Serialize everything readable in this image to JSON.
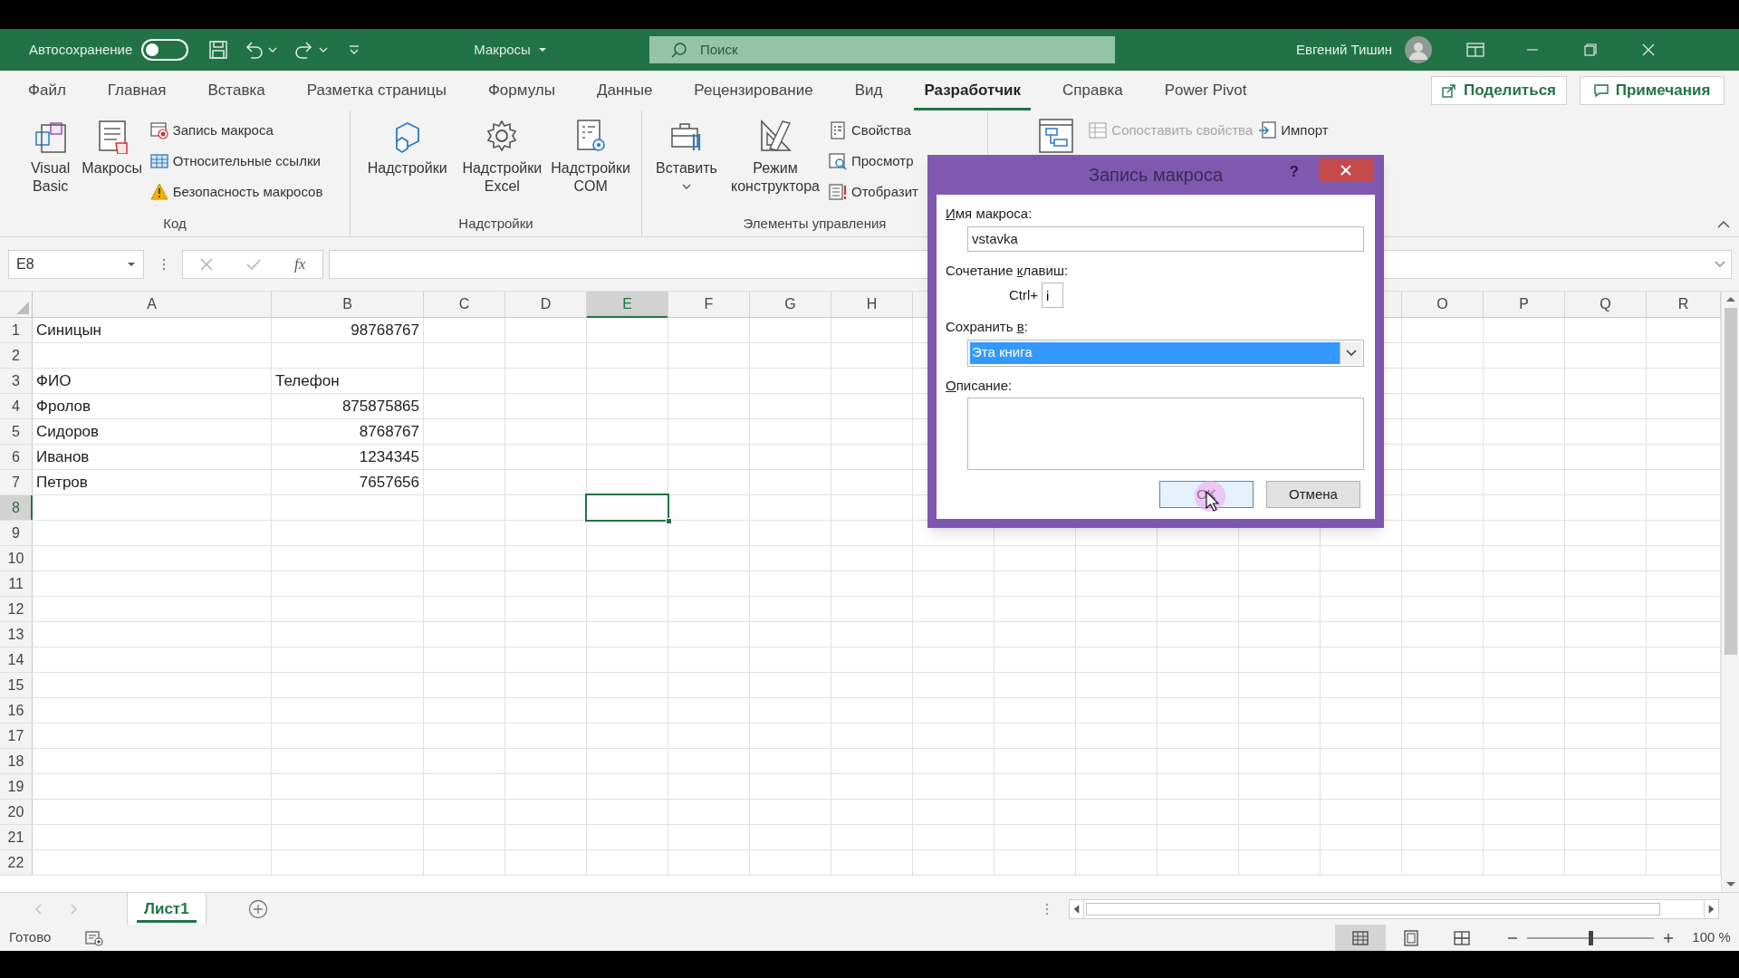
{
  "title_bar": {
    "autosave_label": "Автосохранение",
    "autosave_on": false,
    "document_title": "Макросы",
    "search_placeholder": "Поиск",
    "user_name": "Евгений Тишин"
  },
  "tabs": [
    {
      "label": "Файл",
      "selected": false
    },
    {
      "label": "Главная",
      "selected": false
    },
    {
      "label": "Вставка",
      "selected": false
    },
    {
      "label": "Разметка страницы",
      "selected": false
    },
    {
      "label": "Формулы",
      "selected": false
    },
    {
      "label": "Данные",
      "selected": false
    },
    {
      "label": "Рецензирование",
      "selected": false
    },
    {
      "label": "Вид",
      "selected": false
    },
    {
      "label": "Разработчик",
      "selected": true
    },
    {
      "label": "Справка",
      "selected": false
    },
    {
      "label": "Power Pivot",
      "selected": false
    }
  ],
  "share_button": "Поделиться",
  "comments_button": "Примечания",
  "ribbon": {
    "groups": [
      {
        "label": "Код",
        "items": [
          {
            "kind": "large",
            "label": "Visual Basic"
          },
          {
            "kind": "large",
            "label": "Макросы"
          },
          {
            "kind": "small",
            "label": "Запись макроса",
            "disabled": false
          },
          {
            "kind": "small",
            "label": "Относительные ссылки",
            "disabled": false
          },
          {
            "kind": "small",
            "label": "Безопасность макросов",
            "disabled": false
          }
        ]
      },
      {
        "label": "Надстройки",
        "items": [
          {
            "kind": "large",
            "label": "Надстройки"
          },
          {
            "kind": "large",
            "label": "Надстройки Excel"
          },
          {
            "kind": "large",
            "label": "Надстройки COM"
          }
        ]
      },
      {
        "label": "Элементы управления",
        "items": [
          {
            "kind": "large",
            "label": "Вставить",
            "dropdown": true
          },
          {
            "kind": "large",
            "label": "Режим конструктора"
          },
          {
            "kind": "small",
            "label": "Свойства",
            "disabled": false
          },
          {
            "kind": "small",
            "label": "Просмотр",
            "disabled": false
          },
          {
            "kind": "small",
            "label": "Отобразит",
            "disabled": false
          }
        ]
      },
      {
        "items": [
          {
            "kind": "large"
          },
          {
            "kind": "small",
            "label": "Сопоставить свойства",
            "disabled": true
          },
          {
            "kind": "small",
            "label": "Импорт",
            "disabled": false
          }
        ]
      }
    ]
  },
  "formula_bar": {
    "name_box": "E8",
    "function_button": "fx"
  },
  "columns": [
    {
      "label": "A",
      "selected": false
    },
    {
      "label": "B",
      "selected": false
    },
    {
      "label": "C",
      "selected": false
    },
    {
      "label": "D",
      "selected": false
    },
    {
      "label": "E",
      "selected": true
    },
    {
      "label": "F",
      "selected": false
    },
    {
      "label": "G",
      "selected": false
    },
    {
      "label": "H",
      "selected": false
    },
    {
      "label": "O",
      "selected": false
    },
    {
      "label": "P",
      "selected": false
    },
    {
      "label": "Q",
      "selected": false
    },
    {
      "label": "R",
      "selected": false
    }
  ],
  "rows": [
    {
      "number": "1",
      "selected": false,
      "cells": [
        {
          "text": "Синицын",
          "kind": "text"
        },
        {
          "text": "98768767",
          "kind": "number"
        }
      ]
    },
    {
      "number": "2",
      "selected": false
    },
    {
      "number": "3",
      "selected": false,
      "cells": [
        {
          "text": "ФИО",
          "kind": "text"
        },
        {
          "text": "Телефон",
          "kind": "text"
        }
      ]
    },
    {
      "number": "4",
      "selected": false,
      "cells": [
        {
          "text": "Фролов",
          "kind": "text"
        },
        {
          "text": "875875865",
          "kind": "number"
        }
      ]
    },
    {
      "number": "5",
      "selected": false,
      "cells": [
        {
          "text": "Сидоров",
          "kind": "text"
        },
        {
          "text": "8768767",
          "kind": "number"
        }
      ]
    },
    {
      "number": "6",
      "selected": false,
      "cells": [
        {
          "text": "Иванов",
          "kind": "text"
        },
        {
          "text": "1234345",
          "kind": "number"
        }
      ]
    },
    {
      "number": "7",
      "selected": false,
      "cells": [
        {
          "text": "Петров",
          "kind": "text"
        },
        {
          "text": "7657656",
          "kind": "number"
        }
      ]
    },
    {
      "number": "8",
      "selected": true
    },
    {
      "number": "9",
      "selected": false
    },
    {
      "number": "10",
      "selected": false
    },
    {
      "number": "11",
      "selected": false
    },
    {
      "number": "12",
      "selected": false
    },
    {
      "number": "13",
      "selected": false
    },
    {
      "number": "14",
      "selected": false
    },
    {
      "number": "15",
      "selected": false
    },
    {
      "number": "16",
      "selected": false
    },
    {
      "number": "17",
      "selected": false
    },
    {
      "number": "18",
      "selected": false
    },
    {
      "number": "19",
      "selected": false
    },
    {
      "number": "20",
      "selected": false
    },
    {
      "number": "21",
      "selected": false
    },
    {
      "number": "22",
      "selected": false
    }
  ],
  "sheet_tabs": [
    {
      "label": "Лист1",
      "selected": true
    }
  ],
  "status_bar": {
    "ready": "Готово",
    "views": [
      {
        "selected": true
      },
      {
        "selected": false
      },
      {
        "selected": false
      }
    ],
    "zoom": {
      "level": 0.5,
      "reading": "100 %"
    }
  },
  "dialog": {
    "title": "Запись макроса",
    "help": "?",
    "fields": [
      {
        "kind": "text",
        "label": {
          "key": "И",
          "after": "мя макроса:"
        },
        "value": "vstavka"
      },
      {
        "kind": "shortcut",
        "label": {
          "before": "Сочетание ",
          "key": "к",
          "after": "лавиш:"
        },
        "prefix": "Ctrl+",
        "value": "i"
      },
      {
        "kind": "select",
        "label": {
          "before": "Сохранить ",
          "key": "в",
          "after": ":"
        },
        "value": "Эта книга"
      },
      {
        "kind": "textarea",
        "label": {
          "key": "О",
          "after": "писание:"
        }
      }
    ],
    "buttons": [
      {
        "label": "OK",
        "focused": true
      },
      {
        "label": "Отмена",
        "focused": false
      }
    ]
  }
}
